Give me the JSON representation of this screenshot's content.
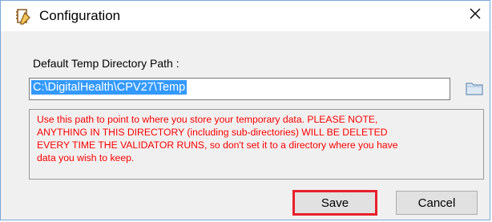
{
  "window": {
    "title": "Configuration",
    "icon": "notepad-icon",
    "close_glyph": "✕"
  },
  "form": {
    "path_label": "Default Temp Directory Path :",
    "path_value": "C:\\DigitalHealth\\CPV27\\Temp",
    "browse_icon": "folder-icon"
  },
  "warning": {
    "lines": [
      "Use this path to point to where you store your temporary data. PLEASE NOTE,",
      "ANYTHING IN THIS DIRECTORY (including sub-directories) WILL BE DELETED",
      "EVERY TIME THE VALIDATOR RUNS, so don't set it to a directory where you have",
      "data you wish to keep."
    ],
    "color": "#ff0000"
  },
  "buttons": {
    "save_label": "Save",
    "cancel_label": "Cancel",
    "highlight_color": "#e8202a"
  }
}
